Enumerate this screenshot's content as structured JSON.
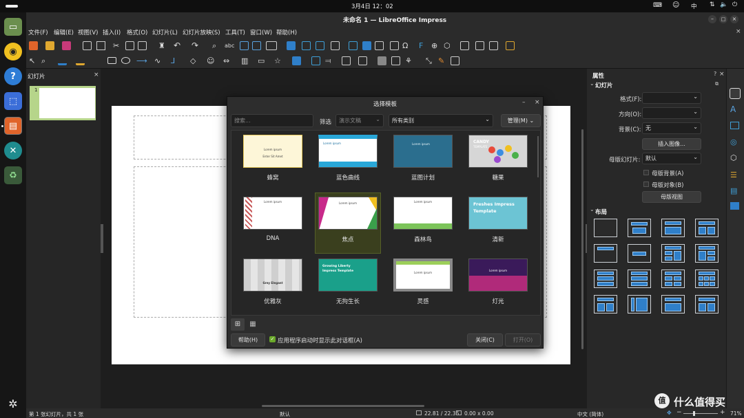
{
  "topbar": {
    "datetime": "3月4日  12：02",
    "ime": "中"
  },
  "window": {
    "title": "未命名 1 — LibreOffice Impress"
  },
  "menu": [
    "文件(F)",
    "编辑(E)",
    "视图(V)",
    "插入(I)",
    "格式(O)",
    "幻灯片(L)",
    "幻灯片放映(S)",
    "工具(T)",
    "窗口(W)",
    "帮助(H)"
  ],
  "slides_pane": {
    "title": "幻灯片",
    "slide_number": "1"
  },
  "sidebar": {
    "title": "属性",
    "section_slide": "幻灯片",
    "format_label": "格式(F):",
    "orientation_label": "方向(O):",
    "background_label": "背景(C):",
    "background_value": "无",
    "insert_image": "插入图像...",
    "master_label": "母版幻灯片:",
    "master_value": "默认",
    "master_background": "母版背景(A)",
    "master_objects": "母版对象(B)",
    "master_view": "母版视图",
    "section_layout": "布局"
  },
  "dialog": {
    "title": "选择模板",
    "search_placeholder": "搜索...",
    "filter_label": "筛选",
    "filter_value": "演示文稿",
    "category_value": "所有类别",
    "manage_label": "管理(M)",
    "help_label": "帮助(H)",
    "show_on_startup": "应用程序启动时显示此对话框(A)",
    "close_label": "关闭(C)",
    "open_label": "打开(O)",
    "templates": [
      {
        "name": "蜂窝",
        "t1": "Lorem ipsum",
        "t2": "Enter Sit Amet"
      },
      {
        "name": "蓝色曲线",
        "t1": "Lorem ipsum",
        "t2": ""
      },
      {
        "name": "蓝图计划",
        "t1": "Lorem ipsum",
        "t2": ""
      },
      {
        "name": "糖果",
        "t1": "CANDY",
        "t2": "TEMPLATE"
      },
      {
        "name": "DNA",
        "t1": "Lorem ipsum",
        "t2": ""
      },
      {
        "name": "焦点",
        "t1": "Lorem ipsum",
        "t2": ""
      },
      {
        "name": "森林鸟",
        "t1": "Lorem ipsum",
        "t2": ""
      },
      {
        "name": "清新",
        "t1": "Freshes Impress",
        "t2": "Template"
      },
      {
        "name": "优雅灰",
        "t1": "Grey Elegant",
        "t2": ""
      },
      {
        "name": "无拘生长",
        "t1": "Growing Liberty",
        "t2": "Impress Template"
      },
      {
        "name": "灵感",
        "t1": "Lorem ipsum",
        "t2": ""
      },
      {
        "name": "灯光",
        "t1": "Lorem ipsum",
        "t2": ""
      }
    ]
  },
  "statusbar": {
    "slide_info": "第 1 张幻灯片，共 1 张",
    "master": "默认",
    "position": "22.81 / 22.36",
    "size": "0.00 x 0.00",
    "language": "中文 (简体)",
    "zoom": "71%"
  },
  "colors": {
    "accent": "#2f7fc9",
    "selected_bg": "#3a3f1e",
    "slide_thumb_border": "#b6d58a"
  }
}
